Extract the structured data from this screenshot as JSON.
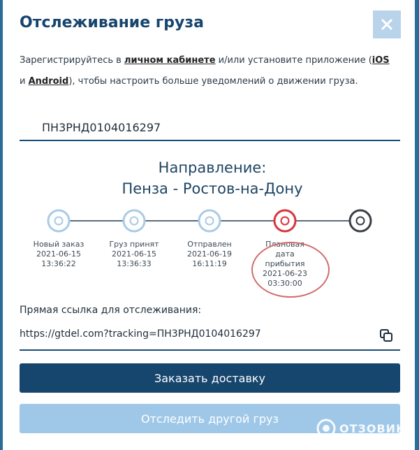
{
  "modal": {
    "title": "Отслеживание груза",
    "close_icon": "close-icon"
  },
  "intro": {
    "part1": "Зарегистрируйтесь в ",
    "account_link": "личном кабинете",
    "part2": " и/или установите приложение (",
    "ios_link": "iOS",
    "part3": " и ",
    "android_link": "Android",
    "part4": "), чтобы настроить больше уведомлений о движении груза."
  },
  "tracking": {
    "number": "ПН3РНД0104016297"
  },
  "route": {
    "heading": "Направление:",
    "cities": "Пенза - Ростов-на-Дону"
  },
  "timeline": {
    "steps": [
      {
        "label": "Новый заказ",
        "date": "2021-06-15",
        "time": "13:36:22",
        "state": "done"
      },
      {
        "label": "Груз принят",
        "date": "2021-06-15",
        "time": "13:36:33",
        "state": "done"
      },
      {
        "label": "Отправлен",
        "date": "2021-06-19",
        "time": "16:11:19",
        "state": "done"
      },
      {
        "label": "Плановая дата прибытия",
        "date": "2021-06-23",
        "time": "03:30:00",
        "state": "current"
      },
      {
        "label": "",
        "date": "",
        "time": "",
        "state": "final"
      }
    ],
    "colors": {
      "done": "#a9cbe6",
      "current": "#d9343c",
      "final": "#3a3f45",
      "line": "#203c55"
    }
  },
  "direct_link": {
    "caption": "Прямая ссылка для отслеживания:",
    "url": "https://gtdel.com?tracking=ПН3РНД0104016297",
    "copy_icon": "copy-icon"
  },
  "buttons": {
    "order_delivery": "Заказать доставку",
    "track_another": "Отследить другой груз"
  },
  "watermark": {
    "text": "ОТЗОВИК"
  },
  "colors": {
    "accent": "#16456d",
    "secondary": "#9fc8e8"
  }
}
